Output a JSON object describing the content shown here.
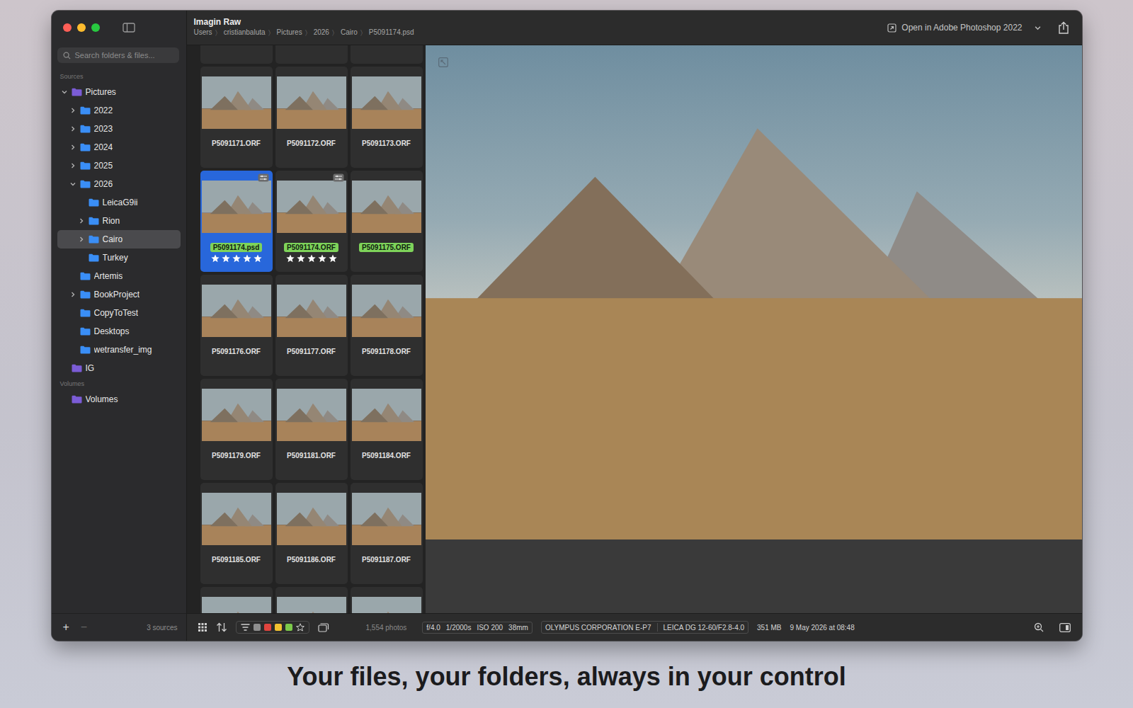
{
  "window": {
    "title": "Imagin Raw",
    "breadcrumb": [
      "Users",
      "cristianbaluta",
      "Pictures",
      "2026",
      "Cairo",
      "P5091174.psd"
    ],
    "breadcrumb_separator": "〉"
  },
  "toolbar": {
    "open_with": "Open in Adobe Photoshop 2022"
  },
  "search": {
    "placeholder": "Search folders & files..."
  },
  "sidebar": {
    "sections": [
      {
        "label": "Sources",
        "items": [
          {
            "label": "Pictures",
            "depth": 0,
            "expandable": true,
            "expanded": true,
            "selected": false,
            "color": "#7b5cd6"
          },
          {
            "label": "2022",
            "depth": 1,
            "expandable": true,
            "expanded": false,
            "selected": false,
            "color": "#3a8ef6"
          },
          {
            "label": "2023",
            "depth": 1,
            "expandable": true,
            "expanded": false,
            "selected": false,
            "color": "#3a8ef6"
          },
          {
            "label": "2024",
            "depth": 1,
            "expandable": true,
            "expanded": false,
            "selected": false,
            "color": "#3a8ef6"
          },
          {
            "label": "2025",
            "depth": 1,
            "expandable": true,
            "expanded": false,
            "selected": false,
            "color": "#3a8ef6"
          },
          {
            "label": "2026",
            "depth": 1,
            "expandable": true,
            "expanded": true,
            "selected": false,
            "color": "#3a8ef6"
          },
          {
            "label": "LeicaG9ii",
            "depth": 2,
            "expandable": false,
            "expanded": false,
            "selected": false,
            "color": "#3a8ef6"
          },
          {
            "label": "Rion",
            "depth": 2,
            "expandable": true,
            "expanded": false,
            "selected": false,
            "color": "#3a8ef6"
          },
          {
            "label": "Cairo",
            "depth": 2,
            "expandable": true,
            "expanded": false,
            "selected": true,
            "color": "#3a8ef6"
          },
          {
            "label": "Turkey",
            "depth": 2,
            "expandable": false,
            "expanded": false,
            "selected": false,
            "color": "#3a8ef6"
          },
          {
            "label": "Artemis",
            "depth": 1,
            "expandable": false,
            "expanded": false,
            "selected": false,
            "color": "#3a8ef6"
          },
          {
            "label": "BookProject",
            "depth": 1,
            "expandable": true,
            "expanded": false,
            "selected": false,
            "color": "#3a8ef6"
          },
          {
            "label": "CopyToTest",
            "depth": 1,
            "expandable": false,
            "expanded": false,
            "selected": false,
            "color": "#3a8ef6"
          },
          {
            "label": "Desktops",
            "depth": 1,
            "expandable": false,
            "expanded": false,
            "selected": false,
            "color": "#3a8ef6"
          },
          {
            "label": "wetransfer_img",
            "depth": 1,
            "expandable": false,
            "expanded": false,
            "selected": false,
            "color": "#3a8ef6"
          },
          {
            "label": "IG",
            "depth": 0,
            "expandable": false,
            "expanded": false,
            "selected": false,
            "color": "#7b5cd6"
          }
        ]
      },
      {
        "label": "Volumes",
        "items": [
          {
            "label": "Volumes",
            "depth": 0,
            "expandable": false,
            "expanded": false,
            "selected": false,
            "color": "#7b5cd6"
          }
        ]
      }
    ],
    "footer": {
      "add": "+",
      "remove": "−",
      "remove_disabled": true,
      "count": "3 sources"
    }
  },
  "grid": {
    "cards": [
      {
        "kind": "clipped-top"
      },
      {
        "kind": "clipped-top"
      },
      {
        "kind": "clipped-top"
      },
      {
        "kind": "full",
        "name": "P5091171.ORF",
        "selected": false,
        "tagged": false,
        "stars": 0,
        "edited": false
      },
      {
        "kind": "full",
        "name": "P5091172.ORF",
        "selected": false,
        "tagged": false,
        "stars": 0,
        "edited": false
      },
      {
        "kind": "full",
        "name": "P5091173.ORF",
        "selected": false,
        "tagged": false,
        "stars": 0,
        "edited": false
      },
      {
        "kind": "full",
        "name": "P5091174.psd",
        "selected": true,
        "tagged": true,
        "stars": 5,
        "edited": true
      },
      {
        "kind": "full",
        "name": "P5091174.ORF",
        "selected": false,
        "tagged": true,
        "stars": 5,
        "edited": true
      },
      {
        "kind": "full",
        "name": "P5091175.ORF",
        "selected": false,
        "tagged": true,
        "stars": 0,
        "edited": false
      },
      {
        "kind": "full",
        "name": "P5091176.ORF",
        "selected": false,
        "tagged": false,
        "stars": 0,
        "edited": false
      },
      {
        "kind": "full",
        "name": "P5091177.ORF",
        "selected": false,
        "tagged": false,
        "stars": 0,
        "edited": false
      },
      {
        "kind": "full",
        "name": "P5091178.ORF",
        "selected": false,
        "tagged": false,
        "stars": 0,
        "edited": false
      },
      {
        "kind": "full",
        "name": "P5091179.ORF",
        "selected": false,
        "tagged": false,
        "stars": 0,
        "edited": false
      },
      {
        "kind": "full",
        "name": "P5091181.ORF",
        "selected": false,
        "tagged": false,
        "stars": 0,
        "edited": false
      },
      {
        "kind": "full",
        "name": "P5091184.ORF",
        "selected": false,
        "tagged": false,
        "stars": 0,
        "edited": false
      },
      {
        "kind": "full",
        "name": "P5091185.ORF",
        "selected": false,
        "tagged": false,
        "stars": 0,
        "edited": false
      },
      {
        "kind": "full",
        "name": "P5091186.ORF",
        "selected": false,
        "tagged": false,
        "stars": 0,
        "edited": false
      },
      {
        "kind": "full",
        "name": "P5091187.ORF",
        "selected": false,
        "tagged": false,
        "stars": 0,
        "edited": false
      },
      {
        "kind": "clipped-bottom"
      },
      {
        "kind": "clipped-bottom"
      },
      {
        "kind": "clipped-bottom"
      }
    ]
  },
  "status_bar": {
    "photo_count": "1,554 photos",
    "color_filters": [
      {
        "color": "#8e8e8e"
      },
      {
        "color": "#e0443e"
      },
      {
        "color": "#f2c230"
      },
      {
        "color": "#7cc94a"
      }
    ],
    "exposure": [
      "f/4.0",
      "1/2000s",
      "ISO 200",
      "38mm"
    ],
    "camera": "OLYMPUS CORPORATION E-P7",
    "lens": "LEICA DG 12-60/F2.8-4.0",
    "file_size": "351 MB",
    "date": "9 May 2026 at 08:48"
  },
  "caption": "Your files, your folders, always in your control"
}
